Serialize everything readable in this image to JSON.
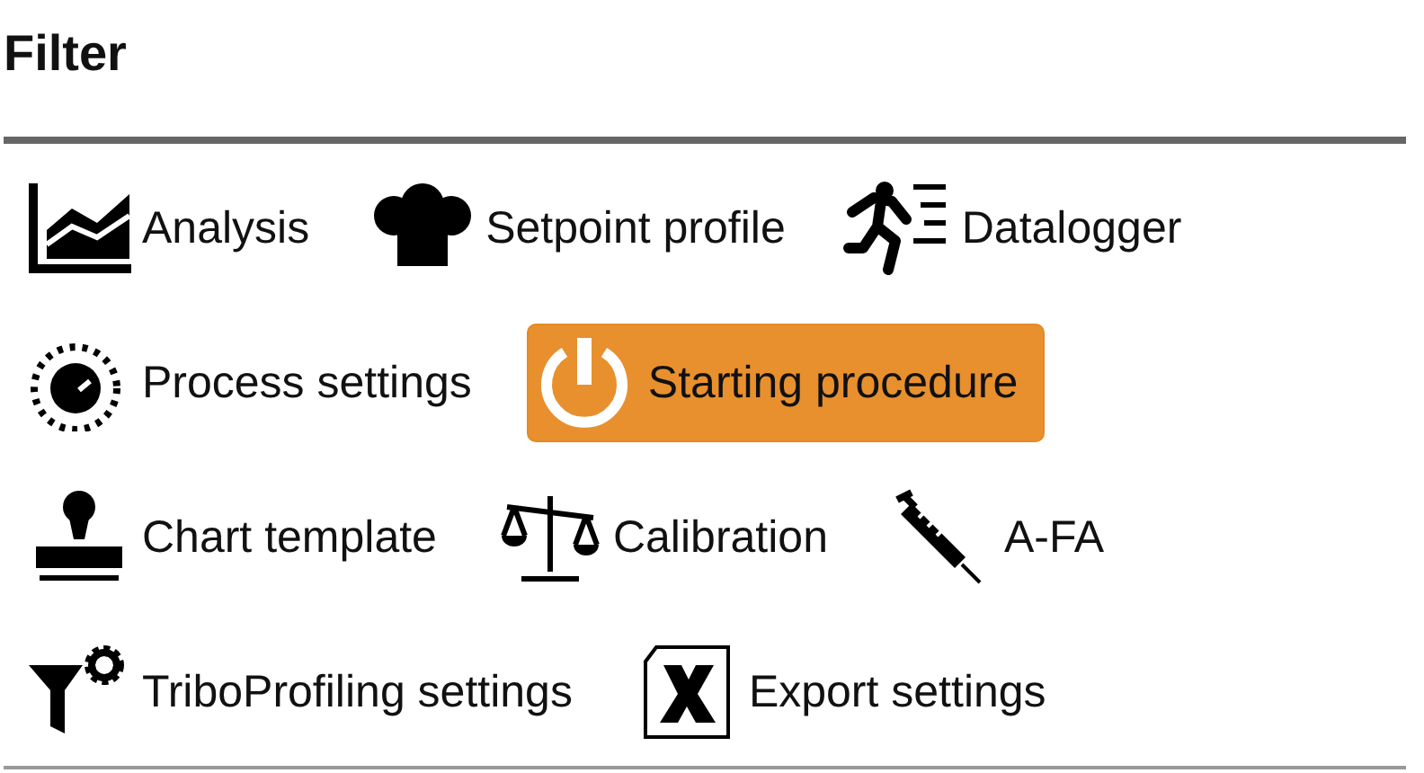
{
  "title": "Filter",
  "rows": [
    [
      {
        "label": "Analysis",
        "kind": "chart",
        "selected": false
      },
      {
        "label": "Setpoint profile",
        "kind": "hat",
        "selected": false
      },
      {
        "label": "Datalogger",
        "kind": "runner",
        "selected": false
      }
    ],
    [
      {
        "label": "Process settings",
        "kind": "knob",
        "selected": false
      },
      {
        "label": "Starting procedure",
        "kind": "power",
        "selected": true
      }
    ],
    [
      {
        "label": "Chart template",
        "kind": "stamp",
        "selected": false
      },
      {
        "label": "Calibration",
        "kind": "scale",
        "selected": false
      },
      {
        "label": "A-FA",
        "kind": "syringe",
        "selected": false
      }
    ],
    [
      {
        "label": "TriboProfiling settings",
        "kind": "funnel",
        "selected": false
      },
      {
        "label": "Export settings",
        "kind": "export",
        "selected": false
      }
    ]
  ]
}
